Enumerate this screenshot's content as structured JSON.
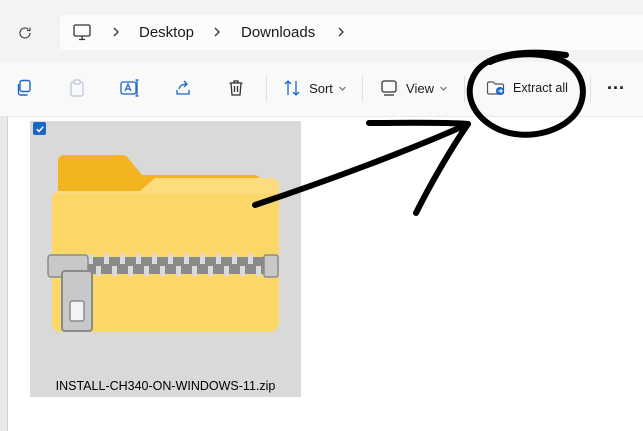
{
  "breadcrumb": {
    "items": [
      "Desktop",
      "Downloads"
    ]
  },
  "toolbar": {
    "sort_label": "Sort",
    "view_label": "View",
    "extract_label": "Extract all",
    "more_label": "..."
  },
  "file": {
    "name": "INSTALL-CH340-ON-WINDOWS-11.zip",
    "selected": true
  },
  "icons": [
    "refresh-icon",
    "this-pc-icon",
    "copy-icon",
    "paste-icon",
    "rename-icon",
    "share-icon",
    "delete-icon",
    "sort-icon",
    "view-icon",
    "extract-icon",
    "zip-folder-icon",
    "checkmark-icon"
  ],
  "colors": {
    "accent": "#1a67c7",
    "folder": "#f7c948",
    "annotation": "#000000"
  }
}
